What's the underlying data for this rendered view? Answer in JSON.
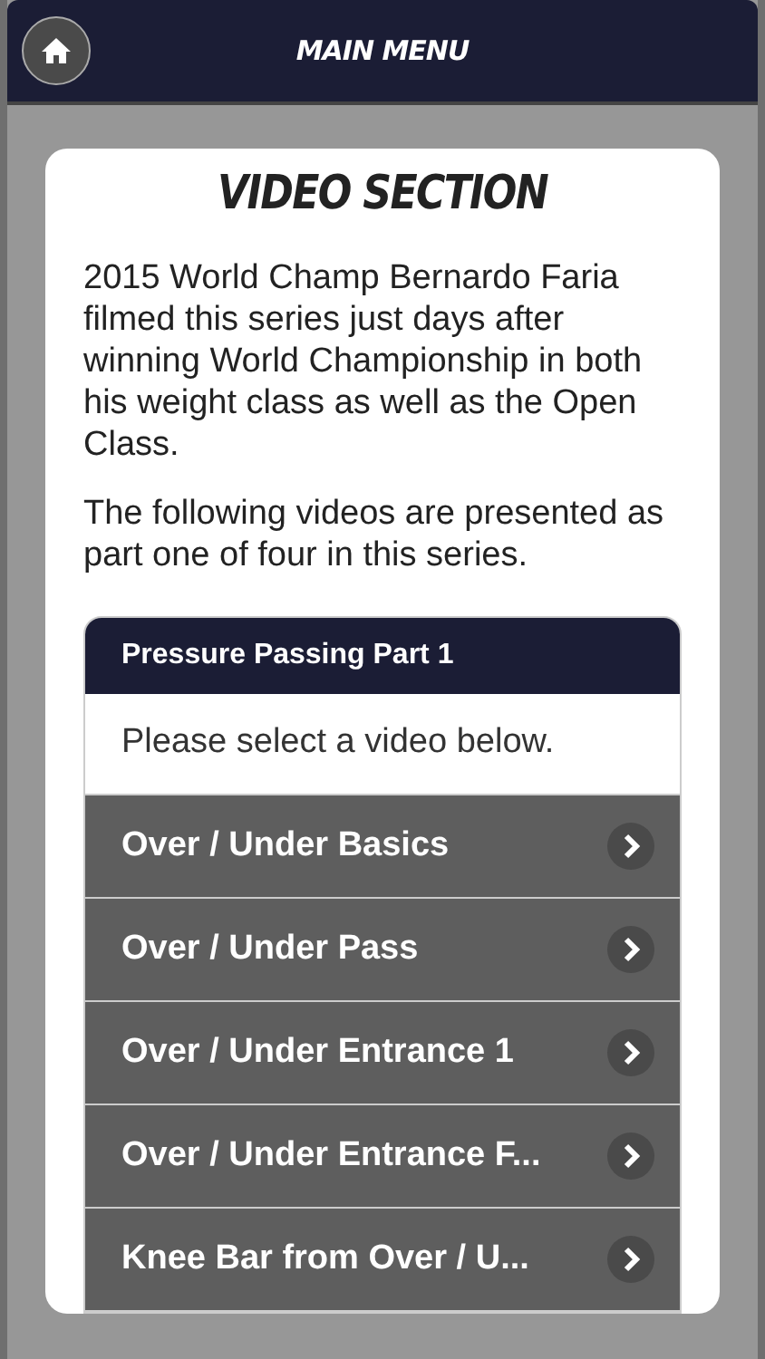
{
  "header": {
    "title": "MAIN MENU"
  },
  "section": {
    "title": "VIDEO SECTION",
    "paragraphs": [
      "2015 World Champ Bernardo Faria filmed this series just days after winning World Championship in both his weight class as well as the Open Class.",
      "The following videos are presented as part one of four in this series."
    ]
  },
  "panel": {
    "title": "Pressure Passing Part 1",
    "prompt": "Please select a video below.",
    "items": [
      {
        "label": "Over / Under Basics"
      },
      {
        "label": "Over / Under Pass"
      },
      {
        "label": "Over / Under Entrance 1"
      },
      {
        "label": "Over / Under Entrance F..."
      },
      {
        "label": "Knee Bar from Over / U..."
      }
    ]
  }
}
